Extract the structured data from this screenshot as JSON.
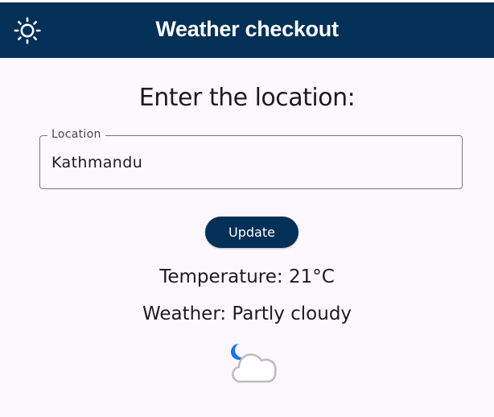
{
  "app": {
    "title": "Weather checkout",
    "theme_icon": "sun-icon"
  },
  "form": {
    "heading": "Enter the location:",
    "location_label": "Location",
    "location_value": "Kathmandu",
    "update_label": "Update"
  },
  "result": {
    "temperature_text": "Temperature: 21°C",
    "weather_text": "Weather: Partly cloudy",
    "weather_icon": "partly-cloudy-night-icon"
  },
  "colors": {
    "primary": "#033056",
    "background": "#fdf8fd",
    "moon": "#1a73e8",
    "cloud": "#9e9e9e"
  }
}
